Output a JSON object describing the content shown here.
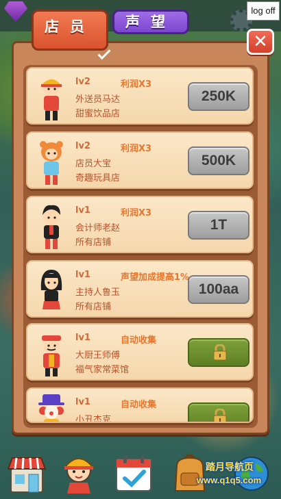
{
  "header": {
    "logoff_label": "log off"
  },
  "tabs": {
    "staff": "店员",
    "reputation": "声望"
  },
  "close_label": "✕",
  "staff_list": [
    {
      "level": "lv2",
      "bonus": "利润X3",
      "name": "外送员马达",
      "shop": "甜蜜饮品店",
      "price": "250K",
      "locked": false,
      "char": "delivery"
    },
    {
      "level": "lv2",
      "bonus": "利润X3",
      "name": "店员大宝",
      "shop": "奇趣玩具店",
      "price": "500K",
      "locked": false,
      "char": "tiger"
    },
    {
      "level": "lv1",
      "bonus": "利润X3",
      "name": "会计师老赵",
      "shop": "所有店铺",
      "price": "1T",
      "locked": false,
      "char": "accountant"
    },
    {
      "level": "lv1",
      "bonus": "声望加成提高1%",
      "name": "主持人鲁玉",
      "shop": "所有店铺",
      "price": "100aa",
      "locked": false,
      "char": "host"
    },
    {
      "level": "lv1",
      "bonus": "自动收集",
      "name": "大厨王师傅",
      "shop": "福气家常菜馆",
      "price": "",
      "locked": true,
      "char": "chef"
    },
    {
      "level": "lv1",
      "bonus": "自动收集",
      "name": "小丑杰克",
      "shop": "",
      "price": "",
      "locked": true,
      "char": "clown"
    }
  ],
  "watermark": {
    "line1": "踏月导航页",
    "line2": "www.q1q5.com"
  },
  "colors": {
    "panel": "#c8865a",
    "card": "#fbe7c8",
    "staff_tab": "#f27a52",
    "reputation_tab": "#9f6ce6",
    "price_button": "#b5b5b5",
    "locked_button": "#6e9030"
  },
  "bottom_nav": [
    "shop-icon",
    "staff-icon",
    "calendar-icon",
    "backpack-icon",
    "globe-icon"
  ]
}
